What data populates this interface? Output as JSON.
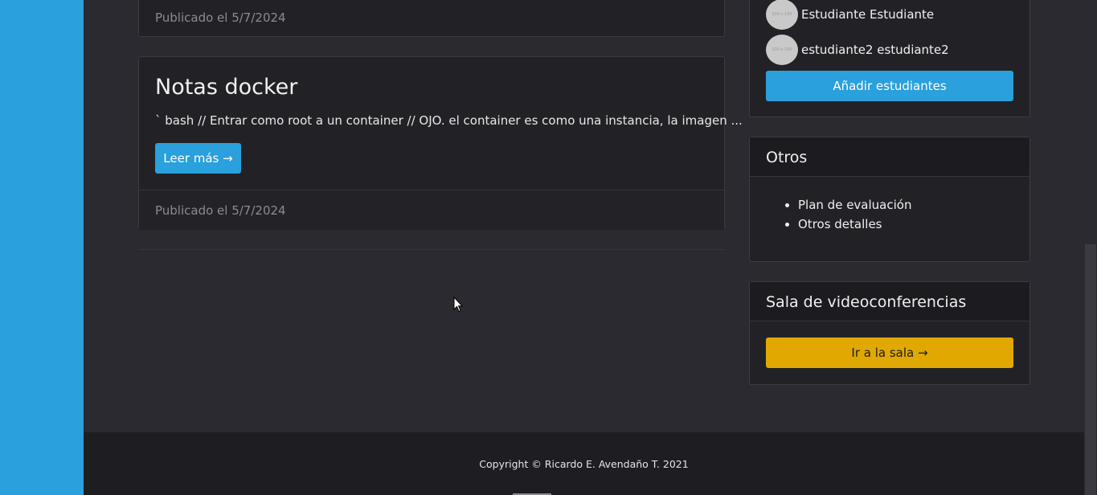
{
  "posts": [
    {
      "published": "Publicado el 5/7/2024"
    },
    {
      "title": "Notas docker",
      "excerpt": "` bash // Entrar como root a un container // OJO. el container es como una instancia, la imagen ...",
      "read_more": "Leer más →",
      "published": "Publicado el 5/7/2024"
    }
  ],
  "students": {
    "items": [
      {
        "name": "Estudiante Estudiante"
      },
      {
        "name": "estudiante2 estudiante2"
      }
    ],
    "add_button": "Añadir estudiantes",
    "avatar_placeholder": "100 x 100"
  },
  "otros": {
    "title": "Otros",
    "items": [
      "Plan de evaluación",
      "Otros detalles"
    ]
  },
  "video": {
    "title": "Sala de videoconferencias",
    "button": "Ir a la sala →"
  },
  "footer": {
    "copyright": "Copyright © Ricardo E. Avendaño T. 2021"
  },
  "colors": {
    "accent": "#2aa0dc",
    "warning": "#e0a800",
    "background": "#2a2a30",
    "card": "#222226"
  },
  "icons": {
    "cursor": "mouse-pointer-icon"
  }
}
